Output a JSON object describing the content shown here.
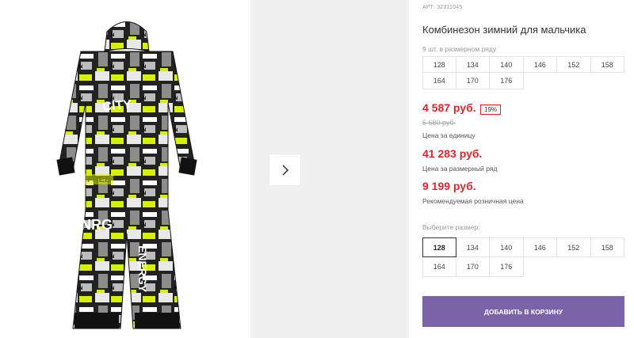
{
  "product": {
    "article_label": "АРТ:",
    "article_number": "32311045",
    "title": "Комбинезон зимний для мальчика",
    "count_text": "9 шт. в размерном ряду",
    "sizes_row_1": [
      "128",
      "134",
      "140",
      "146",
      "152",
      "158"
    ],
    "sizes_row_2": [
      "164",
      "170",
      "176"
    ],
    "unit_price": "4 587 руб.",
    "discount_badge": "19%",
    "old_price": "5 680 руб.",
    "unit_price_caption": "Цена за единицу",
    "range_price": "41 283 руб.",
    "range_price_caption": "Цена за размерный ряд",
    "retail_price": "9 199 руб.",
    "retail_price_caption": "Рекомендуемая розничная цена",
    "choose_size_label": "Выберите размер:",
    "select_sizes_row_1": [
      "128",
      "134",
      "140",
      "146",
      "152",
      "158"
    ],
    "select_sizes_row_2": [
      "164",
      "170",
      "176"
    ],
    "selected_size": "128",
    "add_to_cart_label": "ДОБАВИТЬ В КОРЗИНУ"
  },
  "gallery": {
    "next_icon": "chevron-right-icon",
    "image_print_texts": [
      "FREE",
      "CITY",
      "ENERGY",
      "NRG"
    ]
  },
  "colors": {
    "price_red": "#e3242b",
    "button_purple": "#7b63a8",
    "print_yellow": "#d7f000"
  }
}
